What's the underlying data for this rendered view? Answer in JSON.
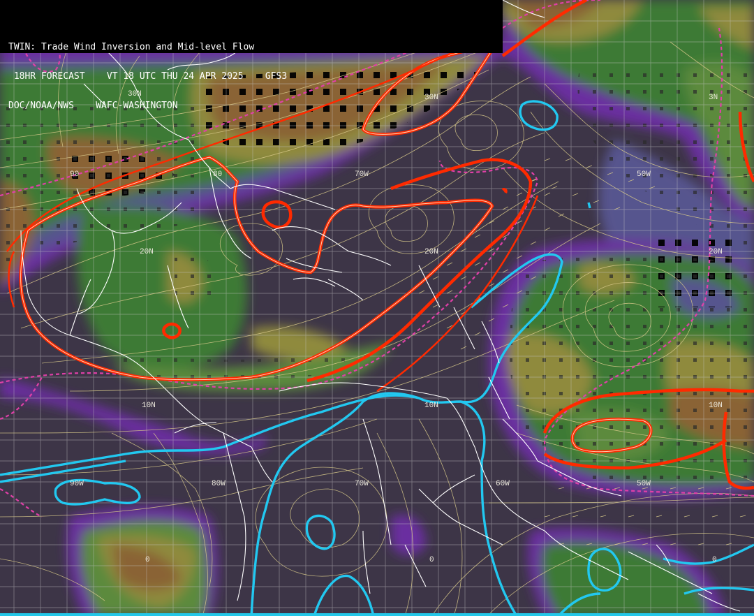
{
  "header": {
    "title": "TWIN: Trade Wind Inversion and Mid-level Flow",
    "forecast": " 18HR FORECAST    VT 18 UTC THU 24 APR 2025    GFS3",
    "source": "DOC/NOAA/NWS    WAFC-WASHINGTON"
  },
  "labels": {
    "lat30_w": "30N",
    "lat30_e": "30N",
    "lat30_fr": "3N",
    "lat20_w": "20N",
    "lat20_c": "20N",
    "lat20_e": "20N",
    "lat10_w": "10N",
    "lat10_c": "10N",
    "lat10_e": "10N",
    "lat0_w": "0",
    "lat0_c": "0",
    "lat0_e": "0",
    "lon90_top": "90",
    "lon80_top": "80",
    "lon70_top": "70W",
    "lon50_top": "50W",
    "lon90_bot": "90W",
    "lon80_bot": "80W",
    "lon70_bot": "70W",
    "lon60_bot": "60W",
    "lon50_bot": "50W"
  },
  "colors": {
    "background": "#3d3547",
    "purple_band": "#6a2fa0",
    "slate_band": "#57548e",
    "green_dark": "#3e7a36",
    "green_mid": "#5b8a3c",
    "olive": "#8f8a3c",
    "brown": "#8a6436",
    "inversion_contour": "#ff2a00",
    "cyan_contour": "#22c8f0",
    "magenta_dashed": "#e040a8",
    "streamline": "#d8c98a",
    "coast": "#ffffff",
    "grid": "#c8c8c8"
  }
}
